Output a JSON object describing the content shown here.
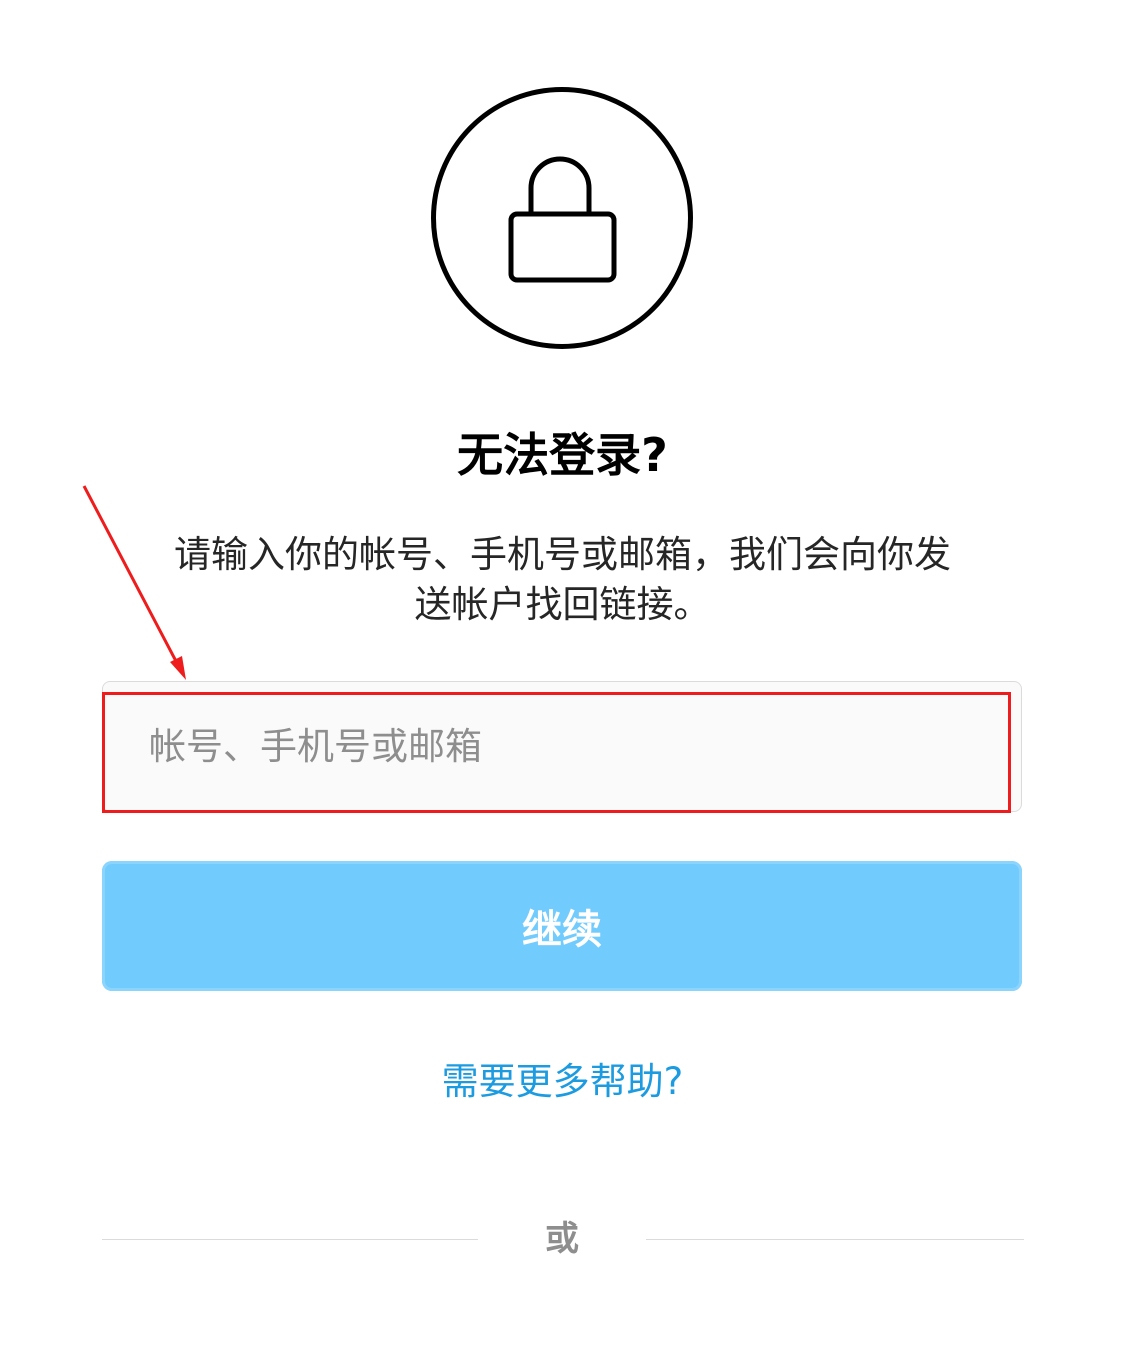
{
  "header": {
    "lock_icon": "lock-icon"
  },
  "main": {
    "title": "无法登录?",
    "description": "请输入你的帐号、手机号或邮箱，我们会向你发送帐户找回链接。",
    "input": {
      "value": "",
      "placeholder": "帐号、手机号或邮箱"
    },
    "continue_label": "继续",
    "help_link": "需要更多帮助?",
    "divider_or": "或"
  },
  "annotation": {
    "highlight_color": "#ee1c1c"
  },
  "colors": {
    "button_bg": "#72cbfd",
    "link": "#1c9be0",
    "placeholder": "#8e8e8e"
  }
}
